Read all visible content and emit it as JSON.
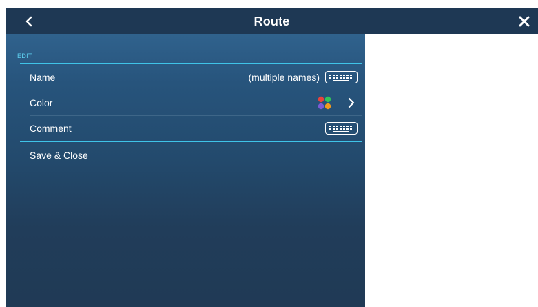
{
  "header": {
    "title": "Route",
    "back_icon": "chevron-left-icon",
    "close_icon": "close-icon"
  },
  "edit_section": {
    "label": "EDIT",
    "rows": [
      {
        "label": "Name",
        "value": "(multiple names)",
        "action_icon": "keyboard-icon"
      },
      {
        "label": "Color",
        "action_icon": "chevron-right-icon",
        "color_icon": "color-palette-icon",
        "palette_colors": [
          "#e8423c",
          "#32c45a",
          "#7b5bd6",
          "#f29a1f"
        ]
      },
      {
        "label": "Comment",
        "action_icon": "keyboard-icon"
      },
      {
        "label": "Save & Close"
      }
    ]
  },
  "colors": {
    "header_bg": "#1e3854",
    "panel_top": "#30628d",
    "panel_bottom": "#203a55",
    "accent_line": "#3fc3e8",
    "section_label": "#5ed0f0"
  }
}
